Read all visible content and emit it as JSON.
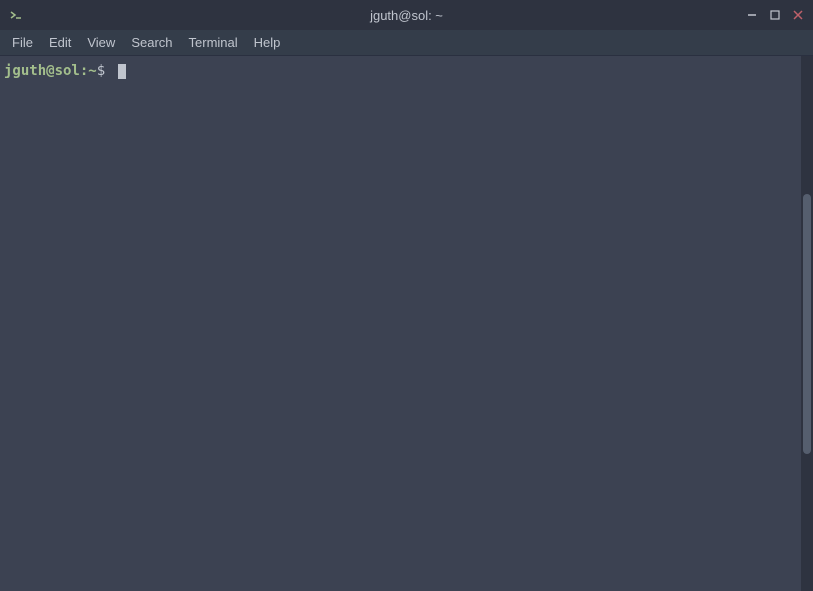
{
  "titlebar": {
    "title": "jguth@sol: ~",
    "icon": "terminal-icon",
    "minimize_label": "minimize",
    "maximize_label": "maximize",
    "close_label": "close"
  },
  "menubar": {
    "items": [
      {
        "id": "file",
        "label": "File"
      },
      {
        "id": "edit",
        "label": "Edit"
      },
      {
        "id": "view",
        "label": "View"
      },
      {
        "id": "search",
        "label": "Search"
      },
      {
        "id": "terminal",
        "label": "Terminal"
      },
      {
        "id": "help",
        "label": "Help"
      }
    ]
  },
  "terminal": {
    "prompt": "jguth@sol:~$ "
  }
}
